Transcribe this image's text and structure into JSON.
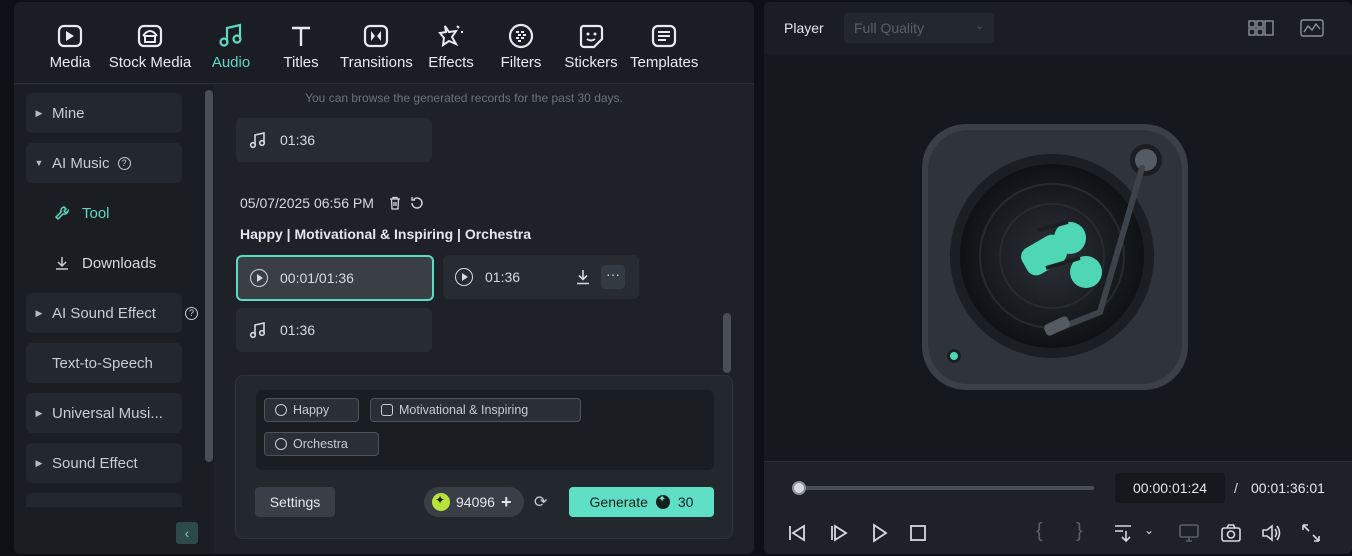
{
  "toolbar": {
    "items": [
      {
        "label": "Media",
        "icon": "media-icon"
      },
      {
        "label": "Stock Media",
        "icon": "stock-media-icon"
      },
      {
        "label": "Audio",
        "icon": "audio-icon",
        "active": true
      },
      {
        "label": "Titles",
        "icon": "titles-icon"
      },
      {
        "label": "Transitions",
        "icon": "transitions-icon"
      },
      {
        "label": "Effects",
        "icon": "effects-icon"
      },
      {
        "label": "Filters",
        "icon": "filters-icon"
      },
      {
        "label": "Stickers",
        "icon": "stickers-icon"
      },
      {
        "label": "Templates",
        "icon": "templates-icon"
      }
    ],
    "active_color": "#5fd9c0"
  },
  "sidebar": {
    "items": [
      {
        "label": "Mine"
      },
      {
        "label": "AI Music"
      },
      {
        "label": "Tool"
      },
      {
        "label": "Downloads"
      },
      {
        "label": "AI Sound Effect"
      },
      {
        "label": "Text-to-Speech"
      },
      {
        "label": "Universal Musi..."
      },
      {
        "label": "Sound Effect"
      }
    ]
  },
  "content": {
    "hint": "You can browse the generated records for the past 30 days.",
    "clip_top": {
      "duration": "01:36"
    },
    "record": {
      "date": "05/07/2025 06:56 PM",
      "title": "Happy | Motivational & Inspiring | Orchestra",
      "clips": [
        {
          "time": "00:01/01:36",
          "selected": true
        },
        {
          "time": "01:36"
        },
        {
          "time": "01:36"
        }
      ]
    }
  },
  "generator": {
    "tags": [
      "Happy",
      "Motivational & Inspiring",
      "Orchestra"
    ],
    "settings_label": "Settings",
    "credits": "94096",
    "generate_label": "Generate",
    "generate_cost": "30",
    "accent": "#5fe0c6"
  },
  "player": {
    "label": "Player",
    "quality": "Full Quality",
    "current_time": "00:00:01:24",
    "separator": "/",
    "total_time": "00:01:36:01",
    "progress": 0.01
  }
}
